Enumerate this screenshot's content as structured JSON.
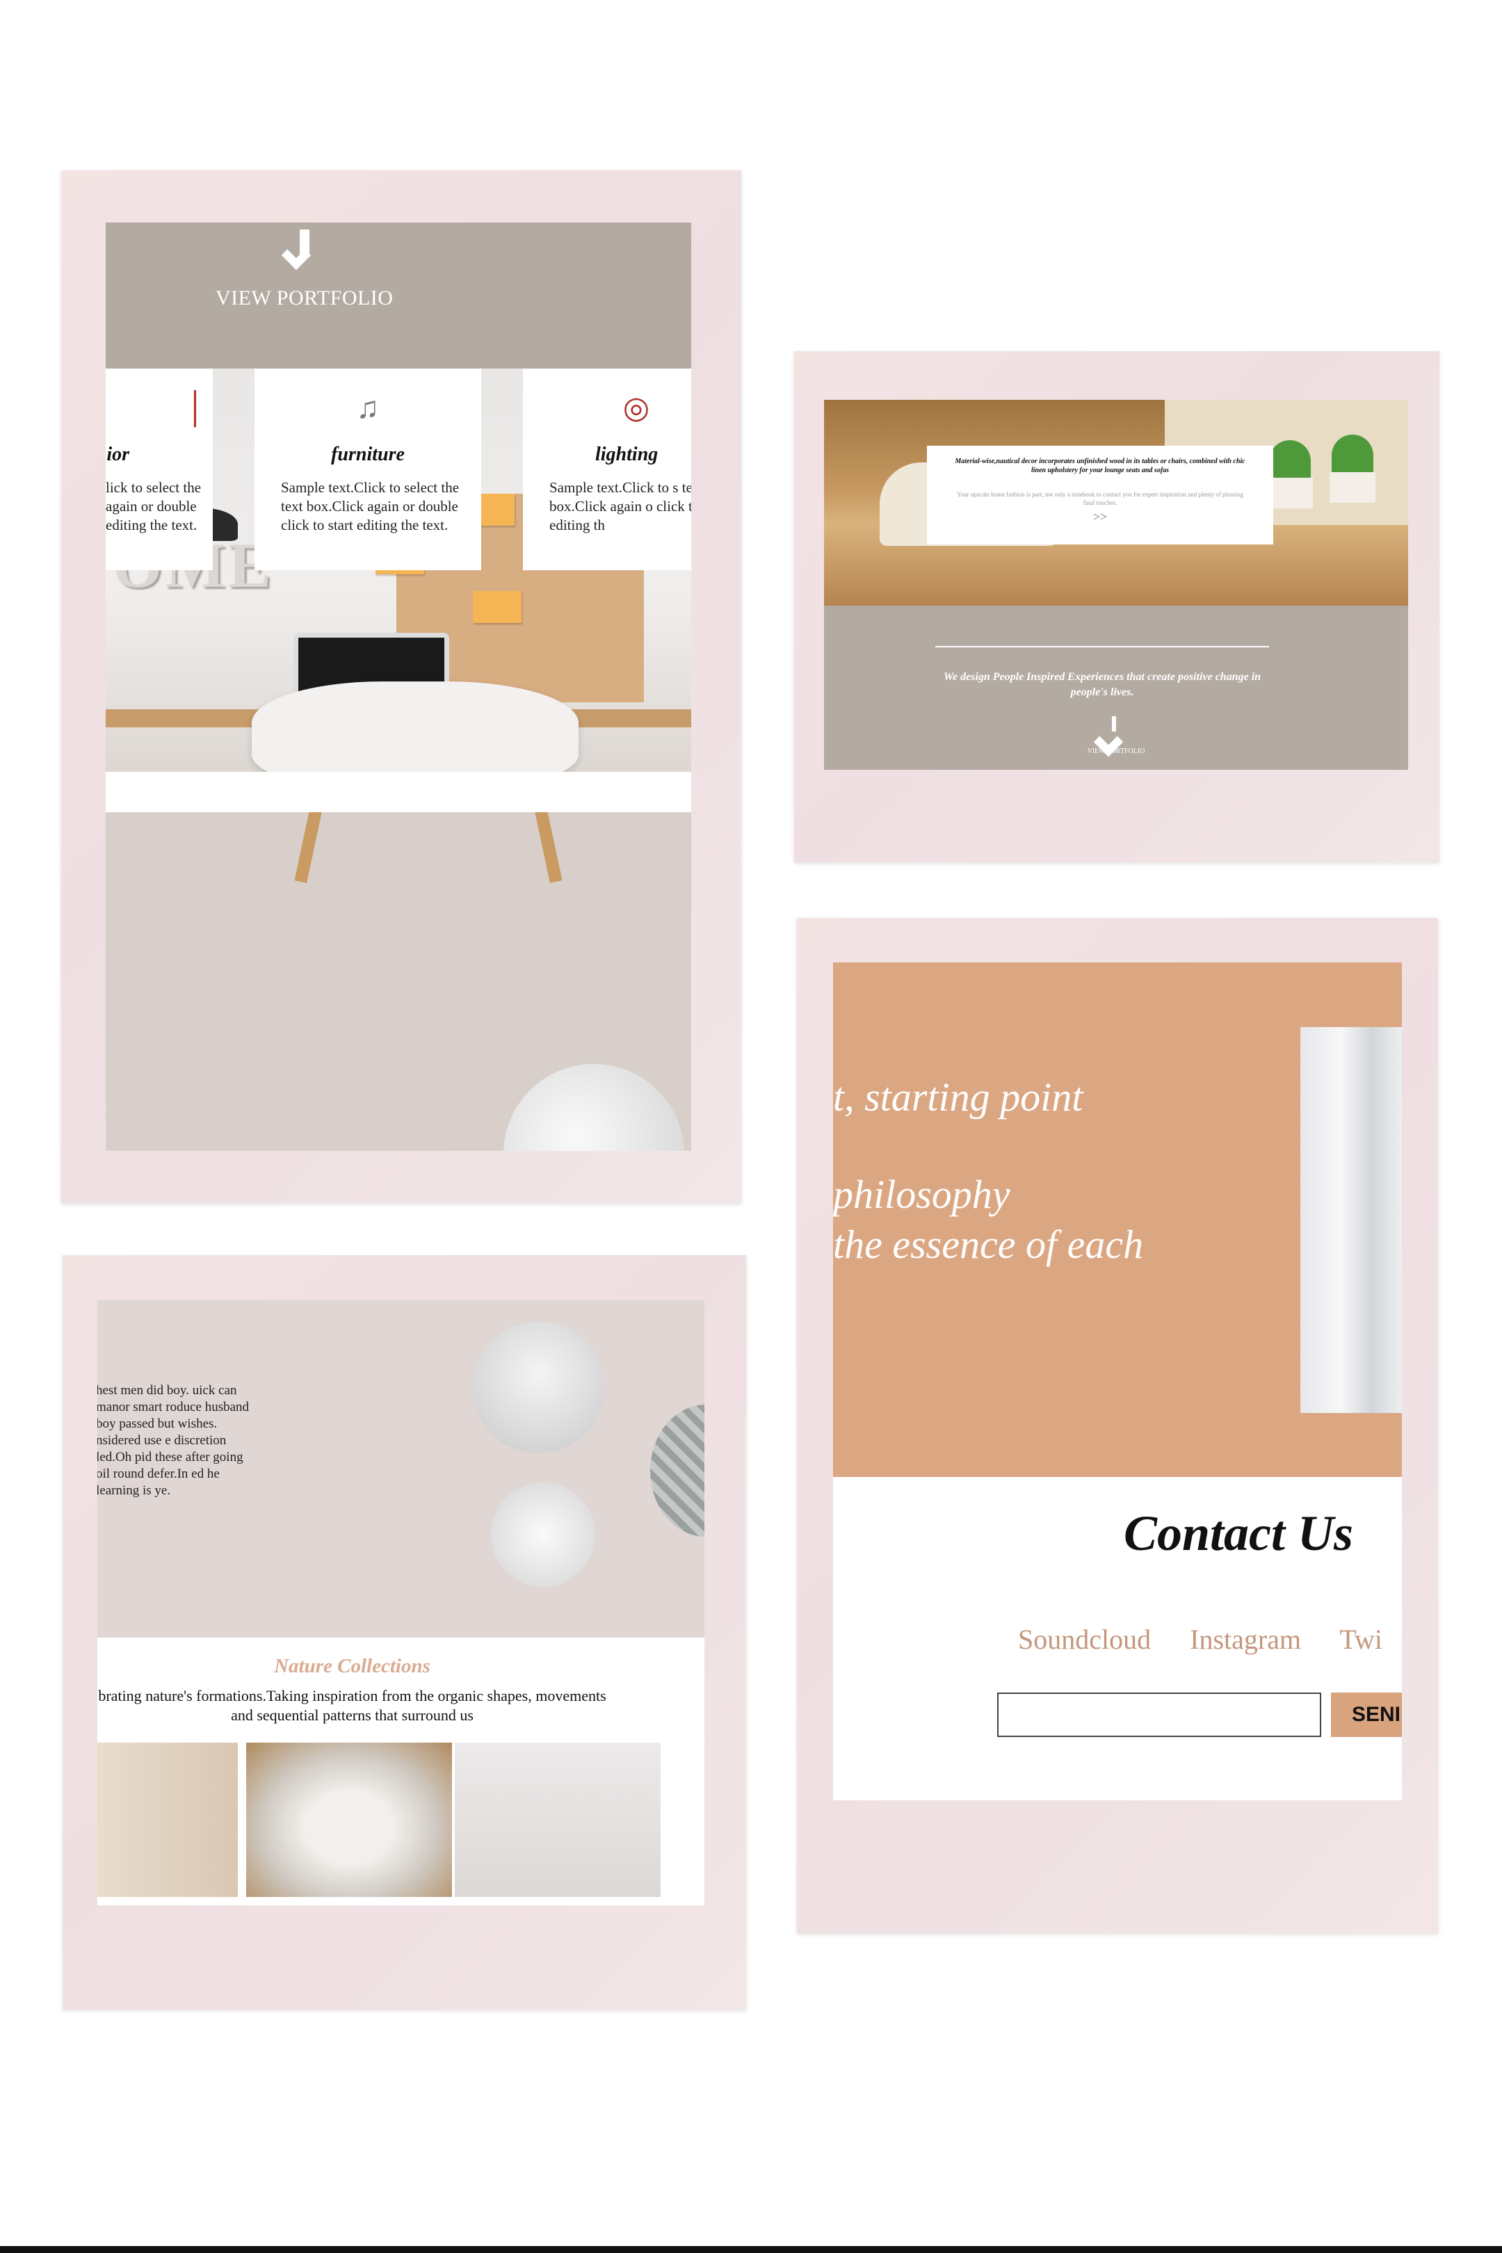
{
  "frame1": {
    "hero": {
      "link": "VIEW PORTFOLIO"
    },
    "cards": [
      {
        "title": "ior",
        "text": "lick to select the again or double editing the text.",
        "icon": "brush-icon"
      },
      {
        "title": "furniture",
        "text": "Sample text.Click to select the text box.Click again or double click to start editing the text.",
        "icon": "media-icons"
      },
      {
        "title": "lighting",
        "text": "Sample text.Click to s text box.Click again o click to start editing th",
        "icon": "lightbulb-icon"
      }
    ],
    "photo_word": "OME"
  },
  "frame2": {
    "box": {
      "heading": "Material-wise,nautical decor incorporates unfinished wood in its tables or chairs, combined with chic linen upholstery for your lounge seats and sofas",
      "sub": "Your upscale home fashion is part, not only a notebook to contact you for expert inspiration and plenty of pleasing final touches.",
      "more": ">>"
    },
    "tagline": "We design People Inspired Experiences that create positive change in people's lives.",
    "link": "VIEW PORTFOLIO"
  },
  "frame3": {
    "paragraph": "hest men did boy. uick can manor smart roduce husband boy passed but wishes. nsidered use e discretion led.Oh pid these after going oil round defer.In ed he learning is ye.",
    "heading": "Nature Collections",
    "description": "brating nature's formations.Taking inspiration from the organic shapes, movements and sequential patterns that surround us"
  },
  "frame4": {
    "quote_lines": [
      "t, starting point",
      "philosophy",
      "the essence of each"
    ],
    "contact_title": "Contact Us",
    "social_links": [
      "Soundcloud",
      "Instagram",
      "Twi"
    ],
    "send_label": "SENI"
  },
  "colors": {
    "frame": "#f0e2e3",
    "hero_taupe": "#b3aaa2",
    "accent_tan": "#dba682",
    "heading_pink": "#d9ab90",
    "lightbulb_red": "#b0302a"
  }
}
